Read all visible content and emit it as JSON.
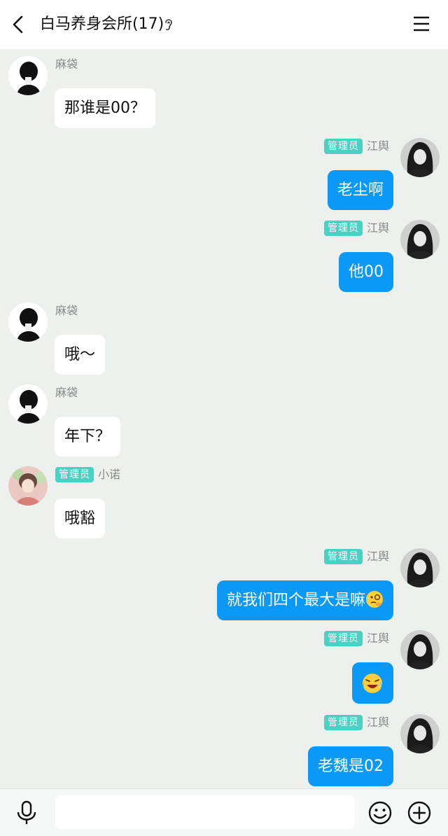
{
  "header": {
    "title": "白马养身会所(17)",
    "back_icon": "chevron-left-icon",
    "ear_icon": "ear-icon",
    "menu_icon": "hamburger-menu-icon"
  },
  "colors": {
    "background": "#edf1ee",
    "header_bg": "#ffffff",
    "outgoing_bubble": "#0a99f7",
    "incoming_bubble": "#ffffff",
    "admin_badge": "#49d1c4"
  },
  "messages": [
    {
      "side": "left",
      "sender": "麻袋",
      "badge": "",
      "text": "那谁是00？",
      "avatar": "avatar-madai"
    },
    {
      "side": "right",
      "sender": "江舆",
      "badge": "管理员",
      "text": "老尘啊",
      "avatar": "avatar-jiangyu"
    },
    {
      "side": "right",
      "sender": "江舆",
      "badge": "管理员",
      "text": "他00",
      "avatar": "avatar-jiangyu"
    },
    {
      "side": "left",
      "sender": "麻袋",
      "badge": "",
      "text": "哦～",
      "avatar": "avatar-madai"
    },
    {
      "side": "left",
      "sender": "麻袋",
      "badge": "",
      "text": "年下？",
      "avatar": "avatar-madai"
    },
    {
      "side": "left",
      "sender": "小诺",
      "badge": "管理员",
      "text": "哦豁",
      "avatar": "avatar-xiaonuo"
    },
    {
      "side": "right",
      "sender": "江舆",
      "badge": "管理员",
      "text": "就我们四个最大是嘛",
      "emoji": "thinking-emoji",
      "avatar": "avatar-jiangyu"
    },
    {
      "side": "right",
      "sender": "江舆",
      "badge": "管理员",
      "text": "",
      "emoji": "laughing-crying-emoji",
      "avatar": "avatar-jiangyu"
    },
    {
      "side": "right",
      "sender": "江舆",
      "badge": "管理员",
      "text": "老魏是02",
      "avatar": "avatar-jiangyu"
    }
  ],
  "input_bar": {
    "value": "",
    "mic_icon": "microphone-icon",
    "emoji_icon": "smiley-icon",
    "plus_icon": "plus-circle-icon"
  }
}
